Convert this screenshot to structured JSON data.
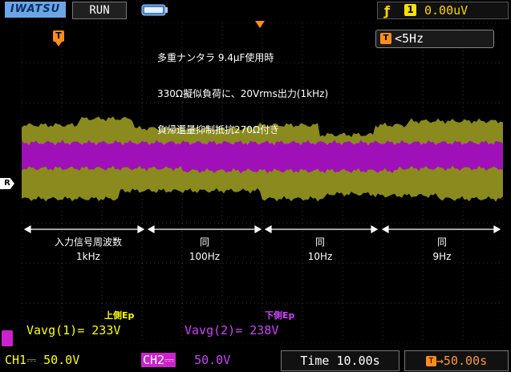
{
  "header": {
    "brand": "IWATSU",
    "run_status": "RUN",
    "trigger_channel": "1",
    "trigger_level": "0.00uV"
  },
  "annotation": {
    "line1": "多重ナンタラ 9.4μF使用時",
    "line2": "330Ω擬似負荷に、20Vrms出力(1kHz)",
    "line3": "負帰還量抑制抵抗270Ω付き"
  },
  "frequency_readout": "<5Hz",
  "markers": {
    "trigger_marker": "T",
    "ref_marker": "R"
  },
  "segments": [
    {
      "line1": "入力信号周波数",
      "line2": "1kHz"
    },
    {
      "line1": "同",
      "line2": "100Hz"
    },
    {
      "line1": "同",
      "line2": "10Hz"
    },
    {
      "line1": "同",
      "line2": "9Hz"
    }
  ],
  "measurements": {
    "upper_label": "上側Ep",
    "upper_value": "Vavg(1)= 233V",
    "lower_label": "下側Ep",
    "lower_value": "Vavg(2)= 238V"
  },
  "footer": {
    "ch1": "CH1⎓  50.0V",
    "ch2_tag": "CH2⎓",
    "ch2_value": "50.0V",
    "time": "Time 10.00s",
    "delay": "50.00s"
  },
  "colors": {
    "ch1_trace": "#8a8a1e",
    "ch2_trace": "#a010b8",
    "ch1_text": "#ffff00",
    "ch2_text": "#cc44ff",
    "trigger": "#ff8c1a"
  }
}
